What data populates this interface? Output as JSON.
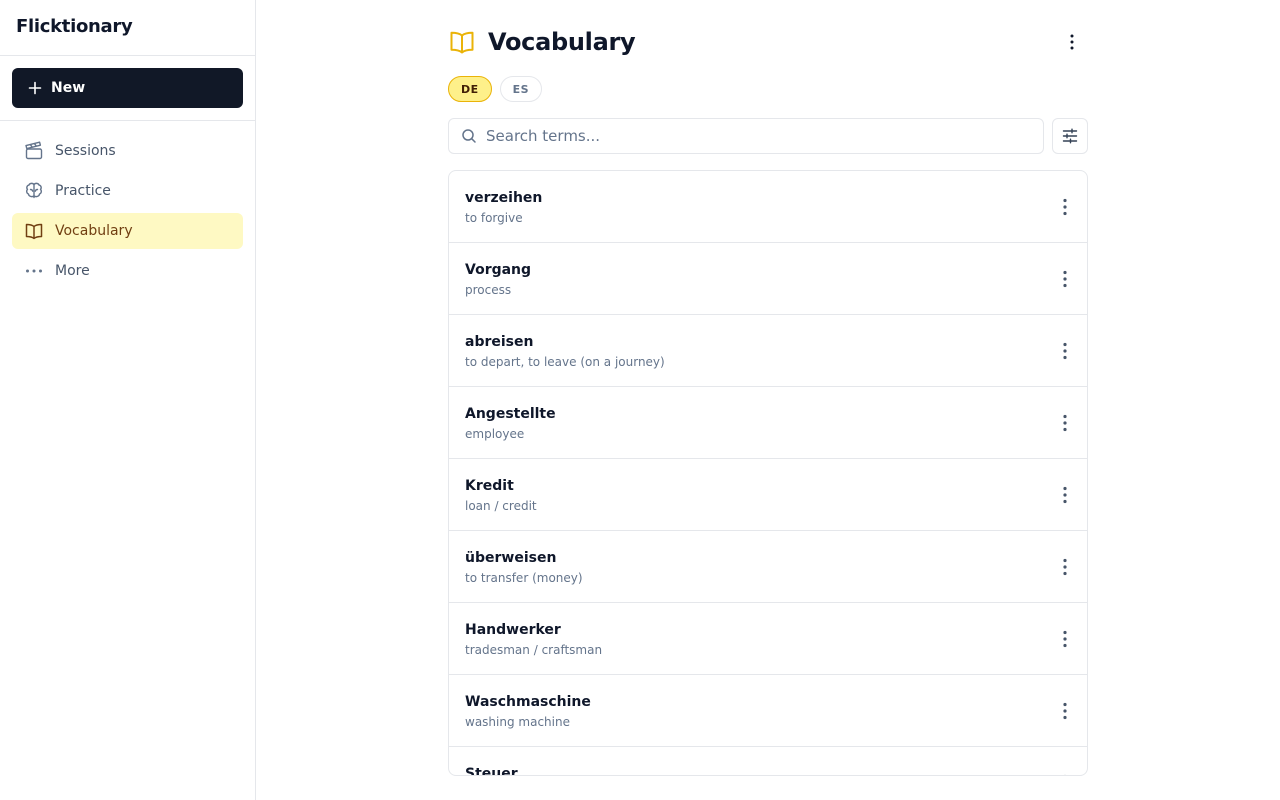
{
  "sidebar": {
    "brand": "Flicktionary",
    "new_label": "New",
    "items": [
      {
        "label": "Sessions",
        "icon": "clapperboard-icon"
      },
      {
        "label": "Practice",
        "icon": "brain-icon"
      },
      {
        "label": "Vocabulary",
        "icon": "book-open-icon",
        "active": true
      },
      {
        "label": "More",
        "icon": "more-horizontal-icon"
      }
    ]
  },
  "main": {
    "title": "Vocabulary",
    "languages": [
      {
        "code": "DE",
        "active": true
      },
      {
        "code": "ES",
        "active": false
      }
    ],
    "search": {
      "placeholder": "Search terms...",
      "value": ""
    },
    "terms": [
      {
        "term": "verzeihen",
        "translation": "to forgive"
      },
      {
        "term": "Vorgang",
        "translation": "process"
      },
      {
        "term": "abreisen",
        "translation": "to depart, to leave (on a journey)"
      },
      {
        "term": "Angestellte",
        "translation": "employee"
      },
      {
        "term": "Kredit",
        "translation": "loan / credit"
      },
      {
        "term": "überweisen",
        "translation": "to transfer (money)"
      },
      {
        "term": "Handwerker",
        "translation": "tradesman / craftsman"
      },
      {
        "term": "Waschmaschine",
        "translation": "washing machine"
      },
      {
        "term": "Steuer",
        "translation": ""
      }
    ]
  },
  "colors": {
    "accent": "#eab308",
    "active_bg": "#fef9c3",
    "dark": "#111827",
    "muted": "#64748b",
    "border": "#e5e7eb"
  }
}
